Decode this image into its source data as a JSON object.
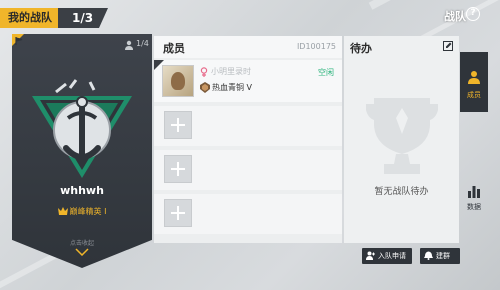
{
  "topbar": {
    "tab_title": "我的战队",
    "tab_count": "1/3",
    "header_title": "战队",
    "help_glyph": "?"
  },
  "team": {
    "member_count": "1/4",
    "name": "whhwh",
    "rank": "巅峰精英 I",
    "collapse_label": "点击收起"
  },
  "members": {
    "title": "成员",
    "team_id": "ID100175",
    "player": {
      "name": "小明里录时",
      "status": "空闲",
      "tier": "热血青铜 V"
    }
  },
  "todo": {
    "title": "待办",
    "empty_message": "暂无战队待办"
  },
  "side_tabs": {
    "members_label": "成员",
    "data_label": "数据"
  },
  "buttons": {
    "join_requests": "入队申请",
    "create_group": "建群"
  },
  "colors": {
    "accent": "#f0b52a",
    "dark_panel": "#2f343a",
    "status_idle": "#2bb37c",
    "gender_female": "#e86a8a"
  },
  "icons": [
    "flag-icon",
    "member-icon",
    "team-emblem",
    "rank-icon",
    "chevron-down-icon",
    "gender-female-icon",
    "tier-bronze-icon",
    "add-icon",
    "edit-icon",
    "trophy-icon",
    "members-icon",
    "bar-chart-icon",
    "join-request-icon",
    "bell-icon",
    "help-icon"
  ]
}
